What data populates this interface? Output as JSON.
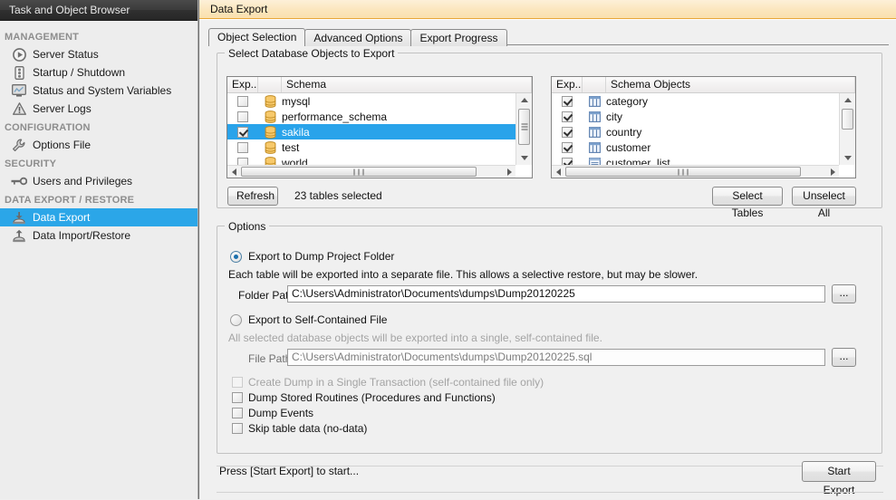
{
  "sidebar": {
    "header": "Task and Object Browser",
    "groups": [
      {
        "title": "MANAGEMENT",
        "items": [
          {
            "label": "Server Status",
            "icon": "play-circle-icon",
            "selected": false
          },
          {
            "label": "Startup / Shutdown",
            "icon": "server-stack-icon",
            "selected": false
          },
          {
            "label": "Status and System Variables",
            "icon": "monitor-chart-icon",
            "selected": false
          },
          {
            "label": "Server Logs",
            "icon": "warning-triangle-icon",
            "selected": false
          }
        ]
      },
      {
        "title": "CONFIGURATION",
        "items": [
          {
            "label": "Options File",
            "icon": "wrench-icon",
            "selected": false
          }
        ]
      },
      {
        "title": "SECURITY",
        "items": [
          {
            "label": "Users and Privileges",
            "icon": "key-icon",
            "selected": false
          }
        ]
      },
      {
        "title": "DATA EXPORT / RESTORE",
        "items": [
          {
            "label": "Data Export",
            "icon": "export-arrow-down-icon",
            "selected": true
          },
          {
            "label": "Data Import/Restore",
            "icon": "import-arrow-up-icon",
            "selected": false
          }
        ]
      }
    ]
  },
  "window": {
    "title": "Data Export",
    "accent_color": "#fae0ae",
    "accent_border": "#e8a73a",
    "selection_color": "#29a3ea"
  },
  "tabs": [
    {
      "label": "Object Selection",
      "active": true
    },
    {
      "label": "Advanced Options",
      "active": false
    },
    {
      "label": "Export Progress",
      "active": false
    }
  ],
  "select_objects": {
    "group_title": "Select Database Objects to Export",
    "schema_list": {
      "columns": [
        "Exp...",
        "",
        "Schema"
      ],
      "rows": [
        {
          "checked": false,
          "name": "mysql",
          "icon": "database-icon",
          "selected": false
        },
        {
          "checked": false,
          "name": "performance_schema",
          "icon": "database-icon",
          "selected": false
        },
        {
          "checked": true,
          "name": "sakila",
          "icon": "database-icon",
          "selected": true
        },
        {
          "checked": false,
          "name": "test",
          "icon": "database-icon",
          "selected": false
        },
        {
          "checked": false,
          "name": "world",
          "icon": "database-icon",
          "selected": false
        }
      ]
    },
    "objects_list": {
      "columns": [
        "Exp...",
        "",
        "Schema Objects"
      ],
      "rows": [
        {
          "checked": true,
          "name": "category",
          "icon": "table-icon",
          "selected": false
        },
        {
          "checked": true,
          "name": "city",
          "icon": "table-icon",
          "selected": false
        },
        {
          "checked": true,
          "name": "country",
          "icon": "table-icon",
          "selected": false
        },
        {
          "checked": true,
          "name": "customer",
          "icon": "table-icon",
          "selected": false
        },
        {
          "checked": true,
          "name": "customer_list",
          "icon": "view-icon",
          "selected": false
        }
      ]
    },
    "refresh_label": "Refresh",
    "status_text": "23 tables selected",
    "select_tables_label": "Select Tables",
    "unselect_all_label": "Unselect All"
  },
  "options": {
    "group_title": "Options",
    "dump_folder": {
      "radio_label": "Export to Dump Project Folder",
      "selected": true,
      "description": "Each table will be exported into a separate file. This allows a selective restore, but may be slower.",
      "path_label": "Folder Path",
      "path_value": "C:\\Users\\Administrator\\Documents\\dumps\\Dump20120225",
      "browse_label": "..."
    },
    "self_contained": {
      "radio_label": "Export to Self-Contained File",
      "selected": false,
      "description": "All selected database objects will be exported into a single, self-contained file.",
      "path_label": "File Path",
      "path_value": "C:\\Users\\Administrator\\Documents\\dumps\\Dump20120225.sql",
      "browse_label": "..."
    },
    "checkboxes": [
      {
        "label": "Create Dump in a Single Transaction (self-contained file only)",
        "checked": false,
        "disabled": true
      },
      {
        "label": "Dump Stored Routines (Procedures and Functions)",
        "checked": false,
        "disabled": false
      },
      {
        "label": "Dump Events",
        "checked": false,
        "disabled": false
      },
      {
        "label": "Skip table data (no-data)",
        "checked": false,
        "disabled": false
      }
    ]
  },
  "footer": {
    "status": "Press [Start Export] to start...",
    "start_export_label": "Start Export"
  }
}
